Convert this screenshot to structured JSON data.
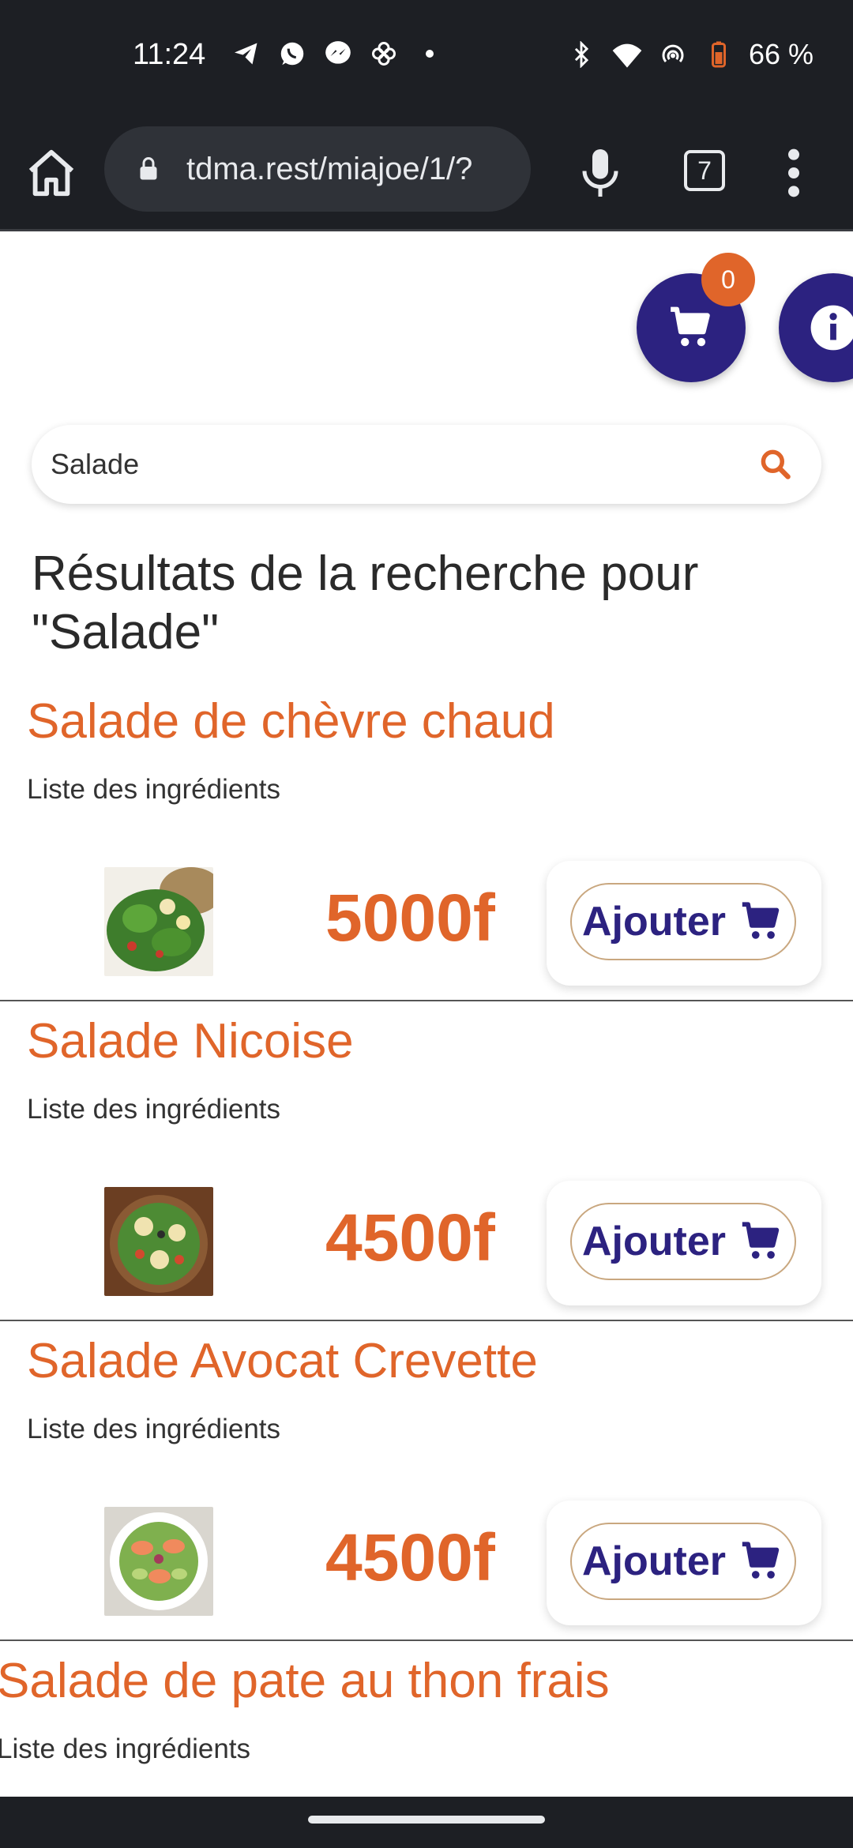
{
  "status_bar": {
    "time": "11:24",
    "battery": "66 %",
    "icons": [
      "telegram-icon",
      "whatsapp-icon",
      "messenger-icon",
      "pinwheel-icon",
      "dot-icon",
      "bluetooth-icon",
      "wifi-icon",
      "hotspot-icon",
      "battery-icon"
    ]
  },
  "browser": {
    "url": "tdma.rest/miajoe/1/?",
    "tab_count": "7"
  },
  "cart": {
    "count": "0"
  },
  "search": {
    "value": "Salade"
  },
  "results_title": "Résultats de la recherche pour \"Salade\"",
  "products": [
    {
      "name": "Salade de chèvre chaud",
      "ingredients": "Liste des ingrédients",
      "price": "5000f",
      "add_label": "Ajouter"
    },
    {
      "name": "Salade Nicoise",
      "ingredients": "Liste des ingrédients",
      "price": "4500f",
      "add_label": "Ajouter"
    },
    {
      "name": "Salade Avocat Crevette",
      "ingredients": "Liste des ingrédients",
      "price": "4500f",
      "add_label": "Ajouter"
    },
    {
      "name": "Salade de pate au thon frais",
      "ingredients": "Liste des ingrédients"
    }
  ],
  "colors": {
    "accent": "#e0652a",
    "primary": "#2c2280",
    "chrome": "#1d1f24"
  }
}
